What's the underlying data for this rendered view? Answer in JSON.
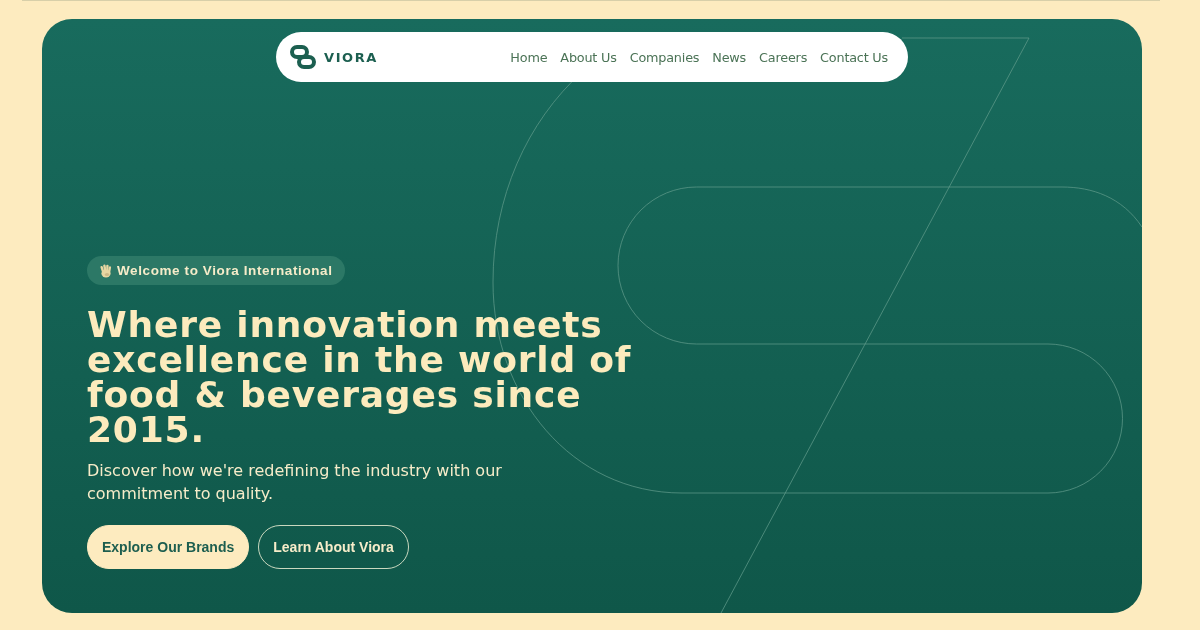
{
  "nav": {
    "logo": "VIORA",
    "links": [
      "Home",
      "About Us",
      "Companies",
      "News",
      "Careers",
      "Contact Us"
    ]
  },
  "hero": {
    "badge": "Welcome to Viora International",
    "headline": "Where innovation meets excellence in the world of food & beverages since 2015.",
    "subtitle": "Discover how we're redefining the industry with our commitment to quality.",
    "buttons": [
      {
        "label": "Explore Our Brands",
        "kind": "primary"
      },
      {
        "label": "Learn About Viora",
        "kind": "secondary"
      }
    ]
  }
}
